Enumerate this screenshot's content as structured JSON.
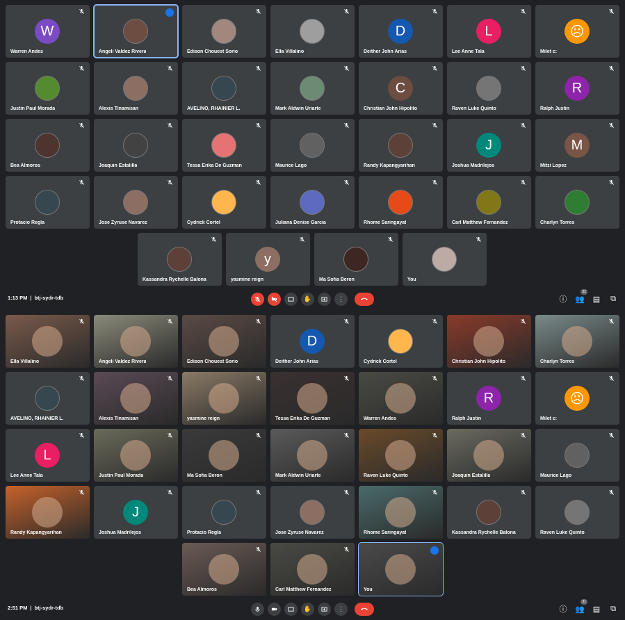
{
  "screen1": {
    "tiles": [
      {
        "name": "Warren Andes",
        "initial": "W",
        "color": "#7b4bc4"
      },
      {
        "name": "Angeli Valdez Rivera",
        "initial": "",
        "color": "#6d4c41",
        "active": true
      },
      {
        "name": "Edison Chouest Sorio",
        "initial": "",
        "color": "#a1887f"
      },
      {
        "name": "Ella Villalino",
        "initial": "",
        "color": "#9e9e9e"
      },
      {
        "name": "Deither John Arias",
        "initial": "D",
        "color": "#1558b0"
      },
      {
        "name": "Lee Anne Tala",
        "initial": "L",
        "color": "#e91e63"
      },
      {
        "name": "Milet c:",
        "initial": "☹",
        "color": "#ff9800"
      },
      {
        "name": "Justin Paul Morada",
        "initial": "",
        "color": "#558b2f"
      },
      {
        "name": "Alexis Tinamisan",
        "initial": "",
        "color": "#8d6e63"
      },
      {
        "name": "AVELINO, RHAINIER L.",
        "initial": "",
        "color": "#37474f"
      },
      {
        "name": "Mark Aldwin Uriarte",
        "initial": "",
        "color": "#6d8b74"
      },
      {
        "name": "Christian John Hipolito",
        "initial": "C",
        "color": "#6d4c41"
      },
      {
        "name": "Raven Luke Quinto",
        "initial": "",
        "color": "#757575"
      },
      {
        "name": "Ralph Justin",
        "initial": "R",
        "color": "#8e24aa"
      },
      {
        "name": "Bea Almoros",
        "initial": "",
        "color": "#4e342e"
      },
      {
        "name": "Joaquin Estalilla",
        "initial": "",
        "color": "#424242"
      },
      {
        "name": "Tessa Erika De Guzman",
        "initial": "",
        "color": "#e57373"
      },
      {
        "name": "Maurice Lago",
        "initial": "",
        "color": "#616161"
      },
      {
        "name": "Randy Kapangyarihan",
        "initial": "",
        "color": "#5d4037"
      },
      {
        "name": "Joshua Madrilejos",
        "initial": "J",
        "color": "#00897b"
      },
      {
        "name": "Mitzi Lopez",
        "initial": "M",
        "color": "#795548"
      },
      {
        "name": "Protacio Regla",
        "initial": "",
        "color": "#37474f"
      },
      {
        "name": "Jose Zyruse Navarez",
        "initial": "",
        "color": "#8d6e63"
      },
      {
        "name": "Cydrick Cortel",
        "initial": "",
        "color": "#ffb74d"
      },
      {
        "name": "Juliana Denise Garcia",
        "initial": "",
        "color": "#5c6bc0"
      },
      {
        "name": "Rhome Saringayat",
        "initial": "",
        "color": "#e64a19"
      },
      {
        "name": "Carl Matthew Fernandez",
        "initial": "",
        "color": "#827717"
      },
      {
        "name": "Charlyn Torres",
        "initial": "",
        "color": "#2e7d32"
      },
      {
        "name": "Kassandra Rychelle Balona",
        "initial": "",
        "color": "#5d4037"
      },
      {
        "name": "yasmine reign",
        "initial": "y",
        "color": "#8d6e63"
      },
      {
        "name": "Ma Sofia Beron",
        "initial": "",
        "color": "#3e2723"
      },
      {
        "name": "You",
        "initial": "",
        "color": "#bcaaa4"
      }
    ],
    "time": "1:13 PM",
    "meeting_code": "btj-sydr-tdb",
    "people_count": "32"
  },
  "screen2": {
    "tiles": [
      {
        "name": "Ella Villalino",
        "initial": "",
        "color": "#7a5a4a",
        "video": true
      },
      {
        "name": "Angeli Valdez Rivera",
        "initial": "",
        "color": "#8a8a7a",
        "video": true
      },
      {
        "name": "Edison Chouest Sorio",
        "initial": "",
        "color": "#5a4a44",
        "video": true
      },
      {
        "name": "Deither John Arias",
        "initial": "D",
        "color": "#1558b0"
      },
      {
        "name": "Cydrick Cortel",
        "initial": "",
        "color": "#ffb74d"
      },
      {
        "name": "Christian John Hipolito",
        "initial": "",
        "color": "#8a3a2a",
        "video": true
      },
      {
        "name": "Charlyn Torres",
        "initial": "",
        "color": "#7a8a8a",
        "video": true
      },
      {
        "name": "AVELINO, RHAINIER L.",
        "initial": "",
        "color": "#37474f"
      },
      {
        "name": "Alexis Tinamisan",
        "initial": "",
        "color": "#5a4a55",
        "video": true
      },
      {
        "name": "yasmine reign",
        "initial": "",
        "color": "#8a7a66",
        "video": true
      },
      {
        "name": "Tessa Erika De Guzman",
        "initial": "",
        "color": "#3a3030",
        "video": true
      },
      {
        "name": "Warren Andes",
        "initial": "",
        "color": "#4a4a44",
        "video": true
      },
      {
        "name": "Ralph Justin",
        "initial": "R",
        "color": "#8e24aa"
      },
      {
        "name": "Milet c:",
        "initial": "☹",
        "color": "#ff9800"
      },
      {
        "name": "Lee Anne Tala",
        "initial": "L",
        "color": "#e91e63"
      },
      {
        "name": "Justin Paul Morada",
        "initial": "",
        "color": "#6a6a5a",
        "video": true
      },
      {
        "name": "Ma Sofia Beron",
        "initial": "",
        "color": "#3a3a3a",
        "video": true
      },
      {
        "name": "Mark Aldwin Uriarte",
        "initial": "",
        "color": "#5a5a5a",
        "video": true
      },
      {
        "name": "Raven Luke Quinto",
        "initial": "",
        "color": "#6a4a2a",
        "video": true
      },
      {
        "name": "Joaquin Estalilla",
        "initial": "",
        "color": "#6a6a60",
        "video": true
      },
      {
        "name": "Maurice Lago",
        "initial": "",
        "color": "#616161"
      },
      {
        "name": "Randy Kapangyarihan",
        "initial": "",
        "color": "#c6622a",
        "video": true
      },
      {
        "name": "Joshua Madrilejos",
        "initial": "J",
        "color": "#00897b"
      },
      {
        "name": "Protacio Regla",
        "initial": "",
        "color": "#37474f"
      },
      {
        "name": "Jose Zyruse Navarez",
        "initial": "",
        "color": "#8d6e63"
      },
      {
        "name": "Rhome Saringayat",
        "initial": "",
        "color": "#4a6a6a",
        "video": true
      },
      {
        "name": "Kassandra Rychelle Balona",
        "initial": "",
        "color": "#5d4037"
      },
      {
        "name": "Raven Luke Quinto",
        "initial": "",
        "color": "#757575"
      },
      {
        "name": "Bea Almoros",
        "initial": "",
        "color": "#6a5a54",
        "video": true
      },
      {
        "name": "Carl Matthew Fernandez",
        "initial": "",
        "color": "#4a4a44",
        "video": true
      },
      {
        "name": "You",
        "initial": "",
        "color": "#4a4a4a",
        "video": true,
        "active": true
      }
    ],
    "time": "2:51 PM",
    "meeting_code": "btj-sydr-tdb",
    "people_count": "31"
  },
  "controls": {
    "mic_icon": "mic-icon",
    "camera_icon": "camera-icon",
    "captions_icon": "captions-icon",
    "raise_hand_icon": "raise-hand-icon",
    "present_icon": "present-icon",
    "more_icon": "more-options-icon",
    "hangup_icon": "hangup-icon",
    "info_icon": "info-icon",
    "people_icon": "people-icon",
    "chat_icon": "chat-icon",
    "activities_icon": "activities-icon"
  }
}
